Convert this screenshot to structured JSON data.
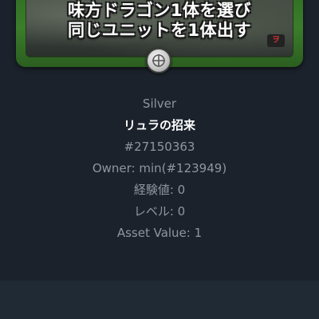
{
  "card": {
    "text_line_1": "味方ドラゴン1体を選び",
    "text_line_2": "同じユニットを1体出す",
    "sticker": "ヲ"
  },
  "item": {
    "rarity": "Silver",
    "name": "リュラの招来",
    "id": "#27150363",
    "owner": "Owner: min(#123949)",
    "experience": "経験値: 0",
    "level": "レベル: 0",
    "asset_value": "Asset Value: 1"
  },
  "colors": {
    "background": "#1b222b",
    "card_frame": "#3b7d2b",
    "muted_text": "#8f96a0",
    "name_text": "#ffffff"
  },
  "icons": {
    "medallion": "silver-crosshair-medallion-icon"
  }
}
